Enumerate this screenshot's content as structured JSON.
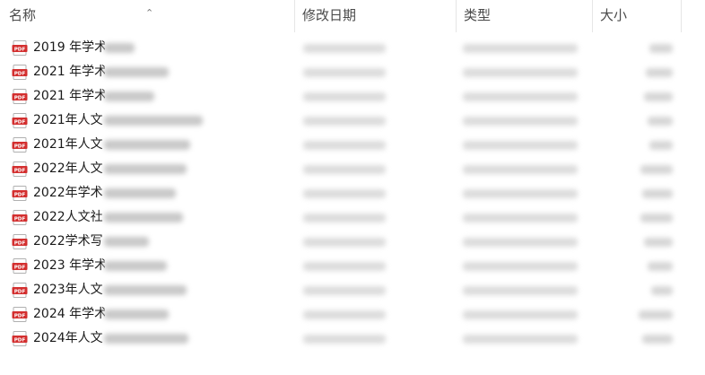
{
  "columns": {
    "name": "名称",
    "date": "修改日期",
    "type": "类型",
    "size": "大小"
  },
  "sort_indicator": "^",
  "files": [
    {
      "name": "2019 年学术"
    },
    {
      "name": "2021 年学术"
    },
    {
      "name": "2021 年学术"
    },
    {
      "name": "2021年人文"
    },
    {
      "name": "2021年人文"
    },
    {
      "name": "2022年人文"
    },
    {
      "name": "2022年学术"
    },
    {
      "name": "2022人文社"
    },
    {
      "name": "2022学术写"
    },
    {
      "name": "2023 年学术"
    },
    {
      "name": "2023年人文"
    },
    {
      "name": "2024 年学术"
    },
    {
      "name": "2024年人文"
    }
  ],
  "colors": {
    "pdf_icon_red": "#d32f2f",
    "header_text": "#4a4a4a"
  }
}
